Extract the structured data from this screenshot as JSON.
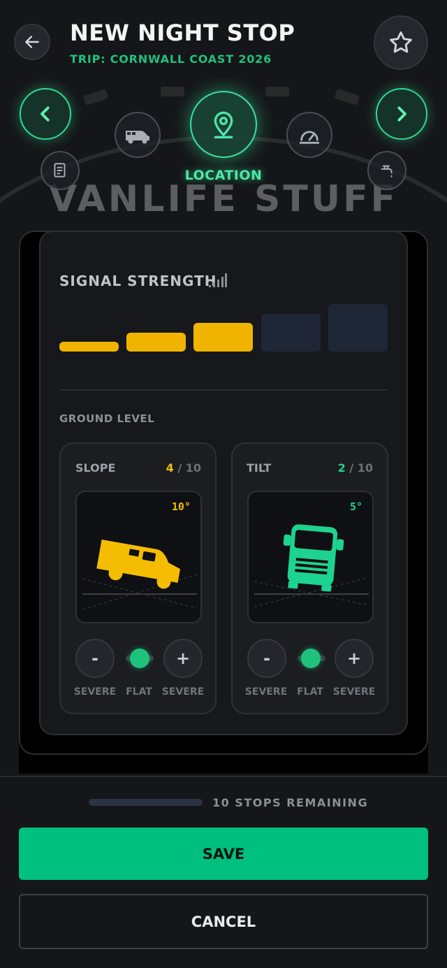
{
  "header": {
    "title": "NEW NIGHT STOP",
    "subtitle": "TRIP: CORNWALL COAST 2026"
  },
  "banner": {
    "brand_text": "VANLIFE STUFF",
    "active_category": "LOCATION",
    "icons": [
      "notes-icon",
      "van-icon",
      "location-pin-icon",
      "speedometer-icon",
      "water-tap-icon"
    ]
  },
  "signal": {
    "title": "SIGNAL STRENGTH",
    "level": 3,
    "max": 5,
    "active_color": "#f0b400",
    "inactive_color": "#1f2737"
  },
  "ground": {
    "label": "GROUND LEVEL",
    "slope": {
      "name": "SLOPE",
      "value": "4",
      "max": "/ 10",
      "angle": "10°",
      "color": "#f5bd02",
      "minus": "-",
      "plus": "+",
      "left_label": "SEVERE",
      "mid_label": "FLAT",
      "right_label": "SEVERE"
    },
    "tilt": {
      "name": "TILT",
      "value": "2",
      "max": "/ 10",
      "angle": "5°",
      "color": "#1ed38f",
      "minus": "-",
      "plus": "+",
      "left_label": "SEVERE",
      "mid_label": "FLAT",
      "right_label": "SEVERE"
    }
  },
  "footer": {
    "remaining": "10 STOPS REMAINING",
    "progress": 0,
    "save_label": "SAVE",
    "cancel_label": "CANCEL"
  },
  "colors": {
    "accent_green": "#00c07f",
    "accent_yellow": "#f0b400",
    "background": "#151619"
  }
}
